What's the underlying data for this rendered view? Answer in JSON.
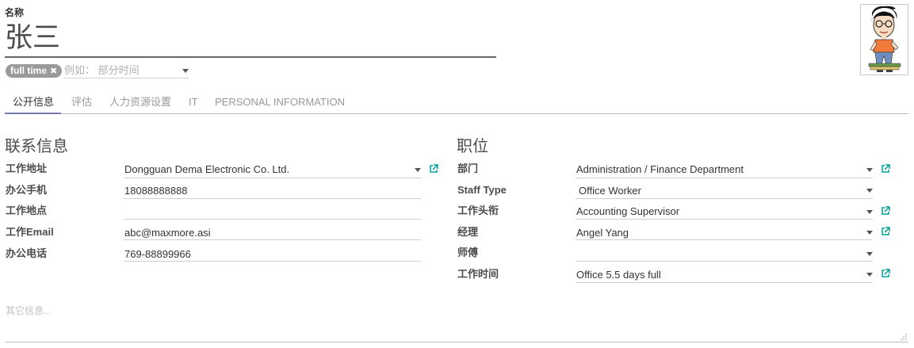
{
  "header": {
    "name_label": "名称",
    "name_value": "张三",
    "tag": "full time",
    "tag_placeholder": "例如： 部分时间"
  },
  "tabs": [
    "公开信息",
    "评估",
    "人力资源设置",
    "IT",
    "PERSONAL INFORMATION"
  ],
  "contact": {
    "title": "联系信息",
    "fields": [
      {
        "label": "工作地址",
        "value": "Dongguan Dema Electronic Co. Ltd."
      },
      {
        "label": "办公手机",
        "value": "18088888888"
      },
      {
        "label": "工作地点",
        "value": ""
      },
      {
        "label": "工作Email",
        "value": "abc@maxmore.asi"
      },
      {
        "label": "办公电话",
        "value": "769-88899966"
      }
    ]
  },
  "position": {
    "title": "职位",
    "fields": [
      {
        "label": "部门",
        "value": "Administration / Finance Department"
      },
      {
        "label": "Staff Type",
        "value": "Office Worker"
      },
      {
        "label": "工作头衔",
        "value": "Accounting Supervisor"
      },
      {
        "label": "经理",
        "value": "Angel Yang"
      },
      {
        "label": "师傅",
        "value": ""
      },
      {
        "label": "工作时间",
        "value": "Office 5.5 days full"
      }
    ]
  },
  "notes": {
    "placeholder": "其它信息..."
  },
  "colors": {
    "accent": "#7c7bad",
    "link_icon": "#00a09d",
    "tag_bg": "#9a9a9a"
  }
}
